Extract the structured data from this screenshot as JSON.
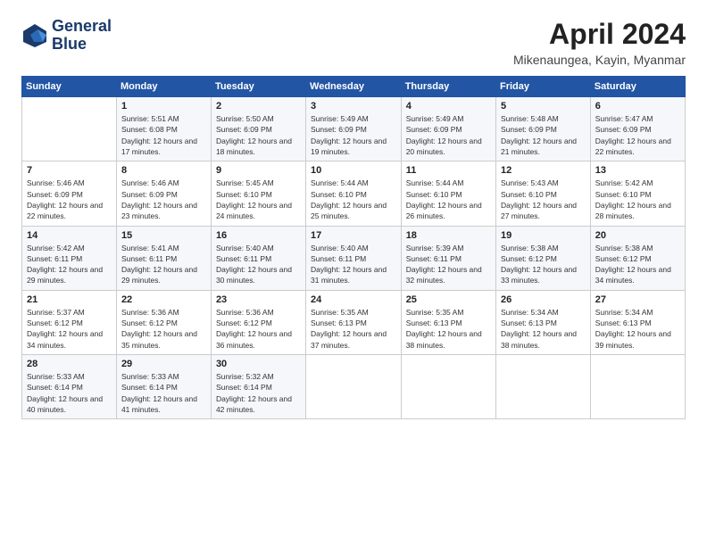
{
  "header": {
    "logo_line1": "General",
    "logo_line2": "Blue",
    "month_year": "April 2024",
    "location": "Mikenaungea, Kayin, Myanmar"
  },
  "weekdays": [
    "Sunday",
    "Monday",
    "Tuesday",
    "Wednesday",
    "Thursday",
    "Friday",
    "Saturday"
  ],
  "weeks": [
    [
      {
        "day": "",
        "sunrise": "",
        "sunset": "",
        "daylight": ""
      },
      {
        "day": "1",
        "sunrise": "Sunrise: 5:51 AM",
        "sunset": "Sunset: 6:08 PM",
        "daylight": "Daylight: 12 hours and 17 minutes."
      },
      {
        "day": "2",
        "sunrise": "Sunrise: 5:50 AM",
        "sunset": "Sunset: 6:09 PM",
        "daylight": "Daylight: 12 hours and 18 minutes."
      },
      {
        "day": "3",
        "sunrise": "Sunrise: 5:49 AM",
        "sunset": "Sunset: 6:09 PM",
        "daylight": "Daylight: 12 hours and 19 minutes."
      },
      {
        "day": "4",
        "sunrise": "Sunrise: 5:49 AM",
        "sunset": "Sunset: 6:09 PM",
        "daylight": "Daylight: 12 hours and 20 minutes."
      },
      {
        "day": "5",
        "sunrise": "Sunrise: 5:48 AM",
        "sunset": "Sunset: 6:09 PM",
        "daylight": "Daylight: 12 hours and 21 minutes."
      },
      {
        "day": "6",
        "sunrise": "Sunrise: 5:47 AM",
        "sunset": "Sunset: 6:09 PM",
        "daylight": "Daylight: 12 hours and 22 minutes."
      }
    ],
    [
      {
        "day": "7",
        "sunrise": "Sunrise: 5:46 AM",
        "sunset": "Sunset: 6:09 PM",
        "daylight": "Daylight: 12 hours and 22 minutes."
      },
      {
        "day": "8",
        "sunrise": "Sunrise: 5:46 AM",
        "sunset": "Sunset: 6:09 PM",
        "daylight": "Daylight: 12 hours and 23 minutes."
      },
      {
        "day": "9",
        "sunrise": "Sunrise: 5:45 AM",
        "sunset": "Sunset: 6:10 PM",
        "daylight": "Daylight: 12 hours and 24 minutes."
      },
      {
        "day": "10",
        "sunrise": "Sunrise: 5:44 AM",
        "sunset": "Sunset: 6:10 PM",
        "daylight": "Daylight: 12 hours and 25 minutes."
      },
      {
        "day": "11",
        "sunrise": "Sunrise: 5:44 AM",
        "sunset": "Sunset: 6:10 PM",
        "daylight": "Daylight: 12 hours and 26 minutes."
      },
      {
        "day": "12",
        "sunrise": "Sunrise: 5:43 AM",
        "sunset": "Sunset: 6:10 PM",
        "daylight": "Daylight: 12 hours and 27 minutes."
      },
      {
        "day": "13",
        "sunrise": "Sunrise: 5:42 AM",
        "sunset": "Sunset: 6:10 PM",
        "daylight": "Daylight: 12 hours and 28 minutes."
      }
    ],
    [
      {
        "day": "14",
        "sunrise": "Sunrise: 5:42 AM",
        "sunset": "Sunset: 6:11 PM",
        "daylight": "Daylight: 12 hours and 29 minutes."
      },
      {
        "day": "15",
        "sunrise": "Sunrise: 5:41 AM",
        "sunset": "Sunset: 6:11 PM",
        "daylight": "Daylight: 12 hours and 29 minutes."
      },
      {
        "day": "16",
        "sunrise": "Sunrise: 5:40 AM",
        "sunset": "Sunset: 6:11 PM",
        "daylight": "Daylight: 12 hours and 30 minutes."
      },
      {
        "day": "17",
        "sunrise": "Sunrise: 5:40 AM",
        "sunset": "Sunset: 6:11 PM",
        "daylight": "Daylight: 12 hours and 31 minutes."
      },
      {
        "day": "18",
        "sunrise": "Sunrise: 5:39 AM",
        "sunset": "Sunset: 6:11 PM",
        "daylight": "Daylight: 12 hours and 32 minutes."
      },
      {
        "day": "19",
        "sunrise": "Sunrise: 5:38 AM",
        "sunset": "Sunset: 6:12 PM",
        "daylight": "Daylight: 12 hours and 33 minutes."
      },
      {
        "day": "20",
        "sunrise": "Sunrise: 5:38 AM",
        "sunset": "Sunset: 6:12 PM",
        "daylight": "Daylight: 12 hours and 34 minutes."
      }
    ],
    [
      {
        "day": "21",
        "sunrise": "Sunrise: 5:37 AM",
        "sunset": "Sunset: 6:12 PM",
        "daylight": "Daylight: 12 hours and 34 minutes."
      },
      {
        "day": "22",
        "sunrise": "Sunrise: 5:36 AM",
        "sunset": "Sunset: 6:12 PM",
        "daylight": "Daylight: 12 hours and 35 minutes."
      },
      {
        "day": "23",
        "sunrise": "Sunrise: 5:36 AM",
        "sunset": "Sunset: 6:12 PM",
        "daylight": "Daylight: 12 hours and 36 minutes."
      },
      {
        "day": "24",
        "sunrise": "Sunrise: 5:35 AM",
        "sunset": "Sunset: 6:13 PM",
        "daylight": "Daylight: 12 hours and 37 minutes."
      },
      {
        "day": "25",
        "sunrise": "Sunrise: 5:35 AM",
        "sunset": "Sunset: 6:13 PM",
        "daylight": "Daylight: 12 hours and 38 minutes."
      },
      {
        "day": "26",
        "sunrise": "Sunrise: 5:34 AM",
        "sunset": "Sunset: 6:13 PM",
        "daylight": "Daylight: 12 hours and 38 minutes."
      },
      {
        "day": "27",
        "sunrise": "Sunrise: 5:34 AM",
        "sunset": "Sunset: 6:13 PM",
        "daylight": "Daylight: 12 hours and 39 minutes."
      }
    ],
    [
      {
        "day": "28",
        "sunrise": "Sunrise: 5:33 AM",
        "sunset": "Sunset: 6:14 PM",
        "daylight": "Daylight: 12 hours and 40 minutes."
      },
      {
        "day": "29",
        "sunrise": "Sunrise: 5:33 AM",
        "sunset": "Sunset: 6:14 PM",
        "daylight": "Daylight: 12 hours and 41 minutes."
      },
      {
        "day": "30",
        "sunrise": "Sunrise: 5:32 AM",
        "sunset": "Sunset: 6:14 PM",
        "daylight": "Daylight: 12 hours and 42 minutes."
      },
      {
        "day": "",
        "sunrise": "",
        "sunset": "",
        "daylight": ""
      },
      {
        "day": "",
        "sunrise": "",
        "sunset": "",
        "daylight": ""
      },
      {
        "day": "",
        "sunrise": "",
        "sunset": "",
        "daylight": ""
      },
      {
        "day": "",
        "sunrise": "",
        "sunset": "",
        "daylight": ""
      }
    ]
  ]
}
